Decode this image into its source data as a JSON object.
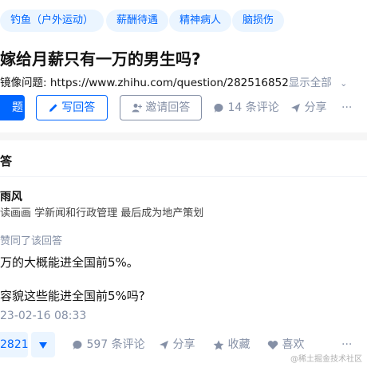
{
  "tags": [
    "钓鱼（户外运动）",
    "薪酬待遇",
    "精神病人",
    "脑损伤"
  ],
  "question": {
    "title": "嫁给月薪只有一万的男生吗?",
    "mirror_label": "镜像问题:",
    "mirror_url": "https://www.zhihu.com/question/282516852",
    "show_all": "显示全部"
  },
  "actions": {
    "follow_label": "题",
    "write_answer": "写回答",
    "invite": "邀请回答",
    "comments": "14 条评论",
    "share": "分享",
    "more": "···"
  },
  "answers_heading": "答",
  "answer": {
    "author": "雨风",
    "bio": "读画画 学新闻和行政管理 最后成为地产策划",
    "agree_note": "赞同了该回答",
    "para1": "万的大概能进全国前5%。",
    "para2": "容貌这些能进全国前5%吗?",
    "date": "23-02-16 08:33",
    "vote_count": "2821",
    "comments": "597 条评论",
    "share": "分享",
    "collect": "收藏",
    "like": "喜欢",
    "more": "···"
  },
  "watermark": "@稀土掘金技术社区",
  "colors": {
    "accent": "#0066ff",
    "muted": "#8590a6",
    "tag_bg": "#ebf5ff"
  }
}
